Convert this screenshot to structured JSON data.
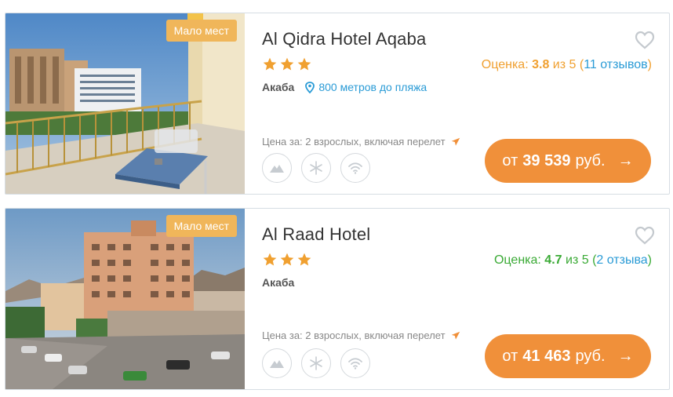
{
  "hotels": [
    {
      "badge": "Мало мест",
      "name": "Al Qidra Hotel Aqaba",
      "stars": 3,
      "rating_label": "Оценка:",
      "rating_value": "3.8",
      "rating_of": "из 5 (",
      "reviews": "11 отзывов",
      "rating_close": ")",
      "rating_color": "#f0a030",
      "city": "Акаба",
      "beach": "800 метров до пляжа",
      "price_for": "Цена за: 2 взрослых, включая перелет",
      "price_prefix": "от",
      "price": "39 539",
      "currency": "руб.",
      "amenities": [
        "mountain-icon",
        "snowflake-icon",
        "wifi-icon"
      ]
    },
    {
      "badge": "Мало мест",
      "name": "Al Raad Hotel",
      "stars": 3,
      "rating_label": "Оценка:",
      "rating_value": "4.7",
      "rating_of": "из 5 (",
      "reviews": "2 отзыва",
      "rating_close": ")",
      "rating_color": "#3aaa35",
      "city": "Акаба",
      "beach": "",
      "price_for": "Цена за: 2 взрослых, включая перелет",
      "price_prefix": "от",
      "price": "41 463",
      "currency": "руб.",
      "amenities": [
        "mountain-icon",
        "snowflake-icon",
        "wifi-icon"
      ]
    }
  ],
  "colors": {
    "accent": "#f0903a",
    "badge": "#f0b65a",
    "link": "#2a9bd6",
    "star": "#f0a030"
  }
}
